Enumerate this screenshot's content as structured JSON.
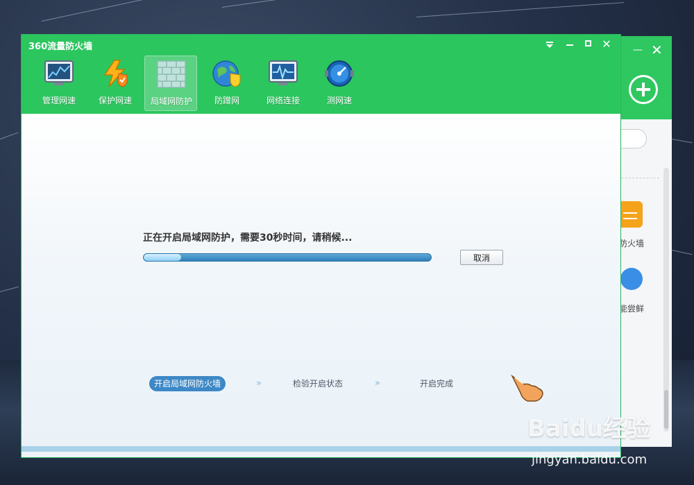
{
  "window": {
    "title": "360流量防火墙",
    "controls": [
      "menu",
      "minimize",
      "maximize",
      "close"
    ]
  },
  "toolbar": {
    "items": [
      {
        "label": "管理网速",
        "icon": "monitor-chart-icon"
      },
      {
        "label": "保护网速",
        "icon": "lightning-shield-icon"
      },
      {
        "label": "局域网防护",
        "icon": "brick-wall-icon",
        "active": true
      },
      {
        "label": "防蹭网",
        "icon": "globe-shield-icon"
      },
      {
        "label": "网络连接",
        "icon": "network-monitor-icon"
      },
      {
        "label": "测网速",
        "icon": "speedometer-icon"
      }
    ]
  },
  "content": {
    "status_text": "正在开启局域网防护，需要30秒时间，请稍候...",
    "progress_fraction": 0.13,
    "cancel_label": "取消",
    "steps": [
      {
        "label": "开启局域网防火墙",
        "active": true
      },
      {
        "label": "检验开启状态",
        "active": false
      },
      {
        "label": "开启完成",
        "active": false
      }
    ]
  },
  "background_window": {
    "texts": [
      "量防火墙",
      "功能尝鲜"
    ]
  },
  "watermark": {
    "brand": "Baidu经验",
    "url": "jingyan.baidu.com"
  },
  "colors": {
    "brand_green": "#2cc65f",
    "progress_blue": "#2e7fb8",
    "step_active": "#3d88c6"
  }
}
